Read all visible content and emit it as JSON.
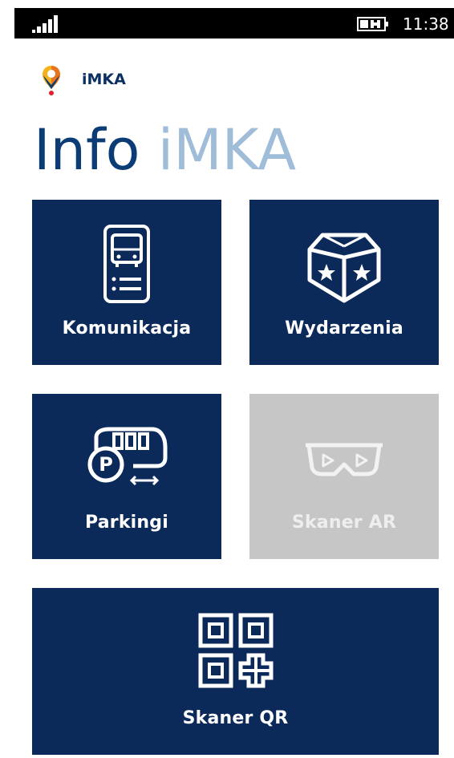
{
  "statusbar": {
    "time": "11:38",
    "signal_icon": "signal-bars-icon",
    "battery_icon": "battery-charging-icon"
  },
  "brand": {
    "name": "iMKA",
    "logo_icon": "map-pin-logo-icon"
  },
  "page_title": {
    "part1": "Info",
    "part2": "iMKA"
  },
  "tiles": [
    {
      "label": "Komunikacja",
      "icon": "bus-schedule-icon",
      "enabled": true
    },
    {
      "label": "Wydarzenia",
      "icon": "event-box-stars-icon",
      "enabled": true
    },
    {
      "label": "Parkingi",
      "icon": "parking-bus-icon",
      "enabled": true
    },
    {
      "label": "Skaner AR",
      "icon": "ar-glasses-icon",
      "enabled": false
    },
    {
      "label": "Skaner QR",
      "icon": "qr-code-icon",
      "enabled": true
    }
  ],
  "colors": {
    "tile_bg": "#0b2a5a",
    "tile_disabled_bg": "#c6c6c6",
    "title_dark": "#0b3c75",
    "title_light": "#9fbcd8",
    "brand_text": "#0b2f63"
  }
}
